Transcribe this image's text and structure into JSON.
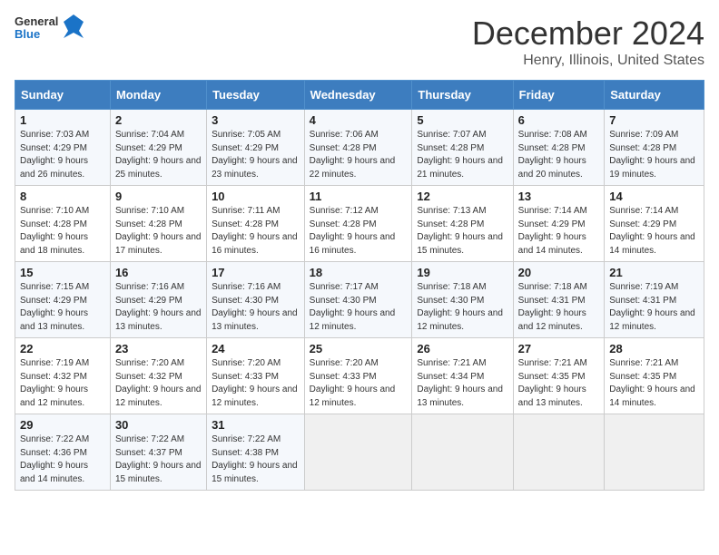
{
  "header": {
    "logo_line1": "General",
    "logo_line2": "Blue",
    "month": "December 2024",
    "location": "Henry, Illinois, United States"
  },
  "weekdays": [
    "Sunday",
    "Monday",
    "Tuesday",
    "Wednesday",
    "Thursday",
    "Friday",
    "Saturday"
  ],
  "weeks": [
    [
      {
        "day": "1",
        "sunrise": "Sunrise: 7:03 AM",
        "sunset": "Sunset: 4:29 PM",
        "daylight": "Daylight: 9 hours and 26 minutes."
      },
      {
        "day": "2",
        "sunrise": "Sunrise: 7:04 AM",
        "sunset": "Sunset: 4:29 PM",
        "daylight": "Daylight: 9 hours and 25 minutes."
      },
      {
        "day": "3",
        "sunrise": "Sunrise: 7:05 AM",
        "sunset": "Sunset: 4:29 PM",
        "daylight": "Daylight: 9 hours and 23 minutes."
      },
      {
        "day": "4",
        "sunrise": "Sunrise: 7:06 AM",
        "sunset": "Sunset: 4:28 PM",
        "daylight": "Daylight: 9 hours and 22 minutes."
      },
      {
        "day": "5",
        "sunrise": "Sunrise: 7:07 AM",
        "sunset": "Sunset: 4:28 PM",
        "daylight": "Daylight: 9 hours and 21 minutes."
      },
      {
        "day": "6",
        "sunrise": "Sunrise: 7:08 AM",
        "sunset": "Sunset: 4:28 PM",
        "daylight": "Daylight: 9 hours and 20 minutes."
      },
      {
        "day": "7",
        "sunrise": "Sunrise: 7:09 AM",
        "sunset": "Sunset: 4:28 PM",
        "daylight": "Daylight: 9 hours and 19 minutes."
      }
    ],
    [
      {
        "day": "8",
        "sunrise": "Sunrise: 7:10 AM",
        "sunset": "Sunset: 4:28 PM",
        "daylight": "Daylight: 9 hours and 18 minutes."
      },
      {
        "day": "9",
        "sunrise": "Sunrise: 7:10 AM",
        "sunset": "Sunset: 4:28 PM",
        "daylight": "Daylight: 9 hours and 17 minutes."
      },
      {
        "day": "10",
        "sunrise": "Sunrise: 7:11 AM",
        "sunset": "Sunset: 4:28 PM",
        "daylight": "Daylight: 9 hours and 16 minutes."
      },
      {
        "day": "11",
        "sunrise": "Sunrise: 7:12 AM",
        "sunset": "Sunset: 4:28 PM",
        "daylight": "Daylight: 9 hours and 16 minutes."
      },
      {
        "day": "12",
        "sunrise": "Sunrise: 7:13 AM",
        "sunset": "Sunset: 4:28 PM",
        "daylight": "Daylight: 9 hours and 15 minutes."
      },
      {
        "day": "13",
        "sunrise": "Sunrise: 7:14 AM",
        "sunset": "Sunset: 4:29 PM",
        "daylight": "Daylight: 9 hours and 14 minutes."
      },
      {
        "day": "14",
        "sunrise": "Sunrise: 7:14 AM",
        "sunset": "Sunset: 4:29 PM",
        "daylight": "Daylight: 9 hours and 14 minutes."
      }
    ],
    [
      {
        "day": "15",
        "sunrise": "Sunrise: 7:15 AM",
        "sunset": "Sunset: 4:29 PM",
        "daylight": "Daylight: 9 hours and 13 minutes."
      },
      {
        "day": "16",
        "sunrise": "Sunrise: 7:16 AM",
        "sunset": "Sunset: 4:29 PM",
        "daylight": "Daylight: 9 hours and 13 minutes."
      },
      {
        "day": "17",
        "sunrise": "Sunrise: 7:16 AM",
        "sunset": "Sunset: 4:30 PM",
        "daylight": "Daylight: 9 hours and 13 minutes."
      },
      {
        "day": "18",
        "sunrise": "Sunrise: 7:17 AM",
        "sunset": "Sunset: 4:30 PM",
        "daylight": "Daylight: 9 hours and 12 minutes."
      },
      {
        "day": "19",
        "sunrise": "Sunrise: 7:18 AM",
        "sunset": "Sunset: 4:30 PM",
        "daylight": "Daylight: 9 hours and 12 minutes."
      },
      {
        "day": "20",
        "sunrise": "Sunrise: 7:18 AM",
        "sunset": "Sunset: 4:31 PM",
        "daylight": "Daylight: 9 hours and 12 minutes."
      },
      {
        "day": "21",
        "sunrise": "Sunrise: 7:19 AM",
        "sunset": "Sunset: 4:31 PM",
        "daylight": "Daylight: 9 hours and 12 minutes."
      }
    ],
    [
      {
        "day": "22",
        "sunrise": "Sunrise: 7:19 AM",
        "sunset": "Sunset: 4:32 PM",
        "daylight": "Daylight: 9 hours and 12 minutes."
      },
      {
        "day": "23",
        "sunrise": "Sunrise: 7:20 AM",
        "sunset": "Sunset: 4:32 PM",
        "daylight": "Daylight: 9 hours and 12 minutes."
      },
      {
        "day": "24",
        "sunrise": "Sunrise: 7:20 AM",
        "sunset": "Sunset: 4:33 PM",
        "daylight": "Daylight: 9 hours and 12 minutes."
      },
      {
        "day": "25",
        "sunrise": "Sunrise: 7:20 AM",
        "sunset": "Sunset: 4:33 PM",
        "daylight": "Daylight: 9 hours and 12 minutes."
      },
      {
        "day": "26",
        "sunrise": "Sunrise: 7:21 AM",
        "sunset": "Sunset: 4:34 PM",
        "daylight": "Daylight: 9 hours and 13 minutes."
      },
      {
        "day": "27",
        "sunrise": "Sunrise: 7:21 AM",
        "sunset": "Sunset: 4:35 PM",
        "daylight": "Daylight: 9 hours and 13 minutes."
      },
      {
        "day": "28",
        "sunrise": "Sunrise: 7:21 AM",
        "sunset": "Sunset: 4:35 PM",
        "daylight": "Daylight: 9 hours and 14 minutes."
      }
    ],
    [
      {
        "day": "29",
        "sunrise": "Sunrise: 7:22 AM",
        "sunset": "Sunset: 4:36 PM",
        "daylight": "Daylight: 9 hours and 14 minutes."
      },
      {
        "day": "30",
        "sunrise": "Sunrise: 7:22 AM",
        "sunset": "Sunset: 4:37 PM",
        "daylight": "Daylight: 9 hours and 15 minutes."
      },
      {
        "day": "31",
        "sunrise": "Sunrise: 7:22 AM",
        "sunset": "Sunset: 4:38 PM",
        "daylight": "Daylight: 9 hours and 15 minutes."
      },
      null,
      null,
      null,
      null
    ]
  ]
}
